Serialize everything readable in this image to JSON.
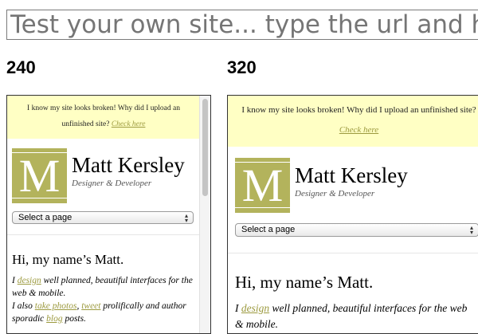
{
  "url_input": {
    "placeholder": "Test your own site... type the url and hit enter"
  },
  "frames": [
    {
      "size_label": "240",
      "notice": {
        "text": "I know my site looks broken! Why did I upload an unfinished site?",
        "link": "Check here"
      },
      "logo": {
        "letter": "M"
      },
      "name": "Matt Kersley",
      "tagline": "Designer & Developer",
      "select": {
        "value": "Select a page"
      },
      "heading": "Hi, my name’s Matt.",
      "body": {
        "line1_pre": "I ",
        "link_design": "design",
        "line1_post": " well planned, beautiful interfaces for the web & mobile.",
        "line2_pre": "I also ",
        "link_photos": "take photos",
        "line2_mid": ", ",
        "link_tweet": "tweet",
        "line2_post": " prolifically and author sporadic ",
        "link_blog": "blog",
        "line2_end": " posts."
      }
    },
    {
      "size_label": "320",
      "notice": {
        "text": "I know my site looks broken! Why did I upload an unfinished site?",
        "link": "Check here"
      },
      "logo": {
        "letter": "M"
      },
      "name": "Matt Kersley",
      "tagline": "Designer & Developer",
      "select": {
        "value": "Select a page"
      },
      "heading": "Hi, my name’s Matt.",
      "body": {
        "line1_pre": "I ",
        "link_design": "design",
        "line1_post": " well planned, beautiful interfaces for the web & mobile."
      }
    }
  ]
}
